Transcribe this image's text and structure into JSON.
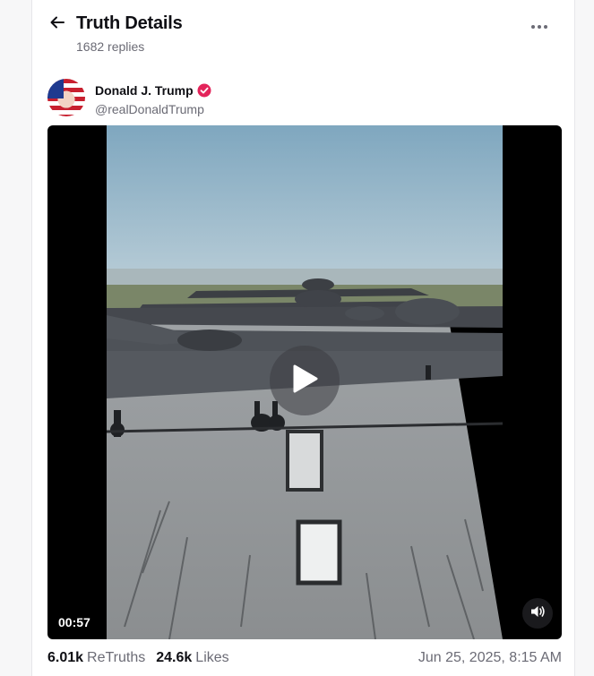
{
  "header": {
    "title": "Truth Details",
    "replies": "1682 replies"
  },
  "post": {
    "author_name": "Donald J. Trump",
    "author_handle": "@realDonaldTrump",
    "verified_color": "#e3245a",
    "video": {
      "duration": "00:57",
      "icons": [
        "play-icon",
        "volume-icon"
      ]
    },
    "stats": {
      "retruths_value": "6.01k",
      "retruths_label": "ReTruths",
      "likes_value": "24.6k",
      "likes_label": "Likes",
      "timestamp": "Jun 25, 2025, 8:15 AM"
    }
  },
  "colors": {
    "text_primary": "#0f0f14",
    "text_secondary": "#6b6b75",
    "background": "#ffffff"
  }
}
